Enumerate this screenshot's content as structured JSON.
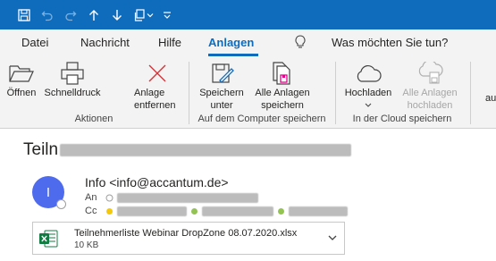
{
  "titlebar": {
    "icons": [
      "save-icon",
      "undo-icon",
      "redo-icon",
      "arrow-up-icon",
      "arrow-down-icon",
      "copy-icon",
      "chevron-down-icon",
      "customize-icon"
    ]
  },
  "menu": {
    "tabs": [
      {
        "label": "Datei",
        "active": false
      },
      {
        "label": "Nachricht",
        "active": false
      },
      {
        "label": "Hilfe",
        "active": false
      },
      {
        "label": "Anlagen",
        "active": true
      }
    ],
    "tell_me": "Was möchten Sie tun?"
  },
  "ribbon": {
    "groups": [
      {
        "label": "Aktionen",
        "buttons": [
          {
            "label": "Öffnen",
            "icon": "folder-open-icon",
            "enabled": true
          },
          {
            "label": "Schnelldruck",
            "icon": "printer-icon",
            "enabled": true
          },
          {
            "label": "Anlage entfernen",
            "icon": "remove-x-icon",
            "enabled": true
          }
        ]
      },
      {
        "label": "Auf dem Computer speichern",
        "buttons": [
          {
            "label": "Speichern unter",
            "icon": "save-as-icon",
            "enabled": true
          },
          {
            "label": "Alle Anlagen speichern",
            "icon": "save-all-icon",
            "enabled": true
          }
        ]
      },
      {
        "label": "In der Cloud speichern",
        "buttons": [
          {
            "label": "Hochladen",
            "icon": "cloud-upload-icon",
            "enabled": true
          },
          {
            "label": "Alle Anlagen hochladen",
            "icon": "cloud-upload-all-icon",
            "enabled": false
          }
        ]
      }
    ],
    "overflow_text": "au"
  },
  "message": {
    "subject_visible": "Teiln",
    "avatar_initial": "I",
    "sender": "Info <info@accantum.de>",
    "to_label": "An",
    "cc_label": "Cc"
  },
  "attachment": {
    "filename": "Teilnehmerliste Webinar DropZone 08.07.2020.xlsx",
    "size": "10 KB"
  }
}
